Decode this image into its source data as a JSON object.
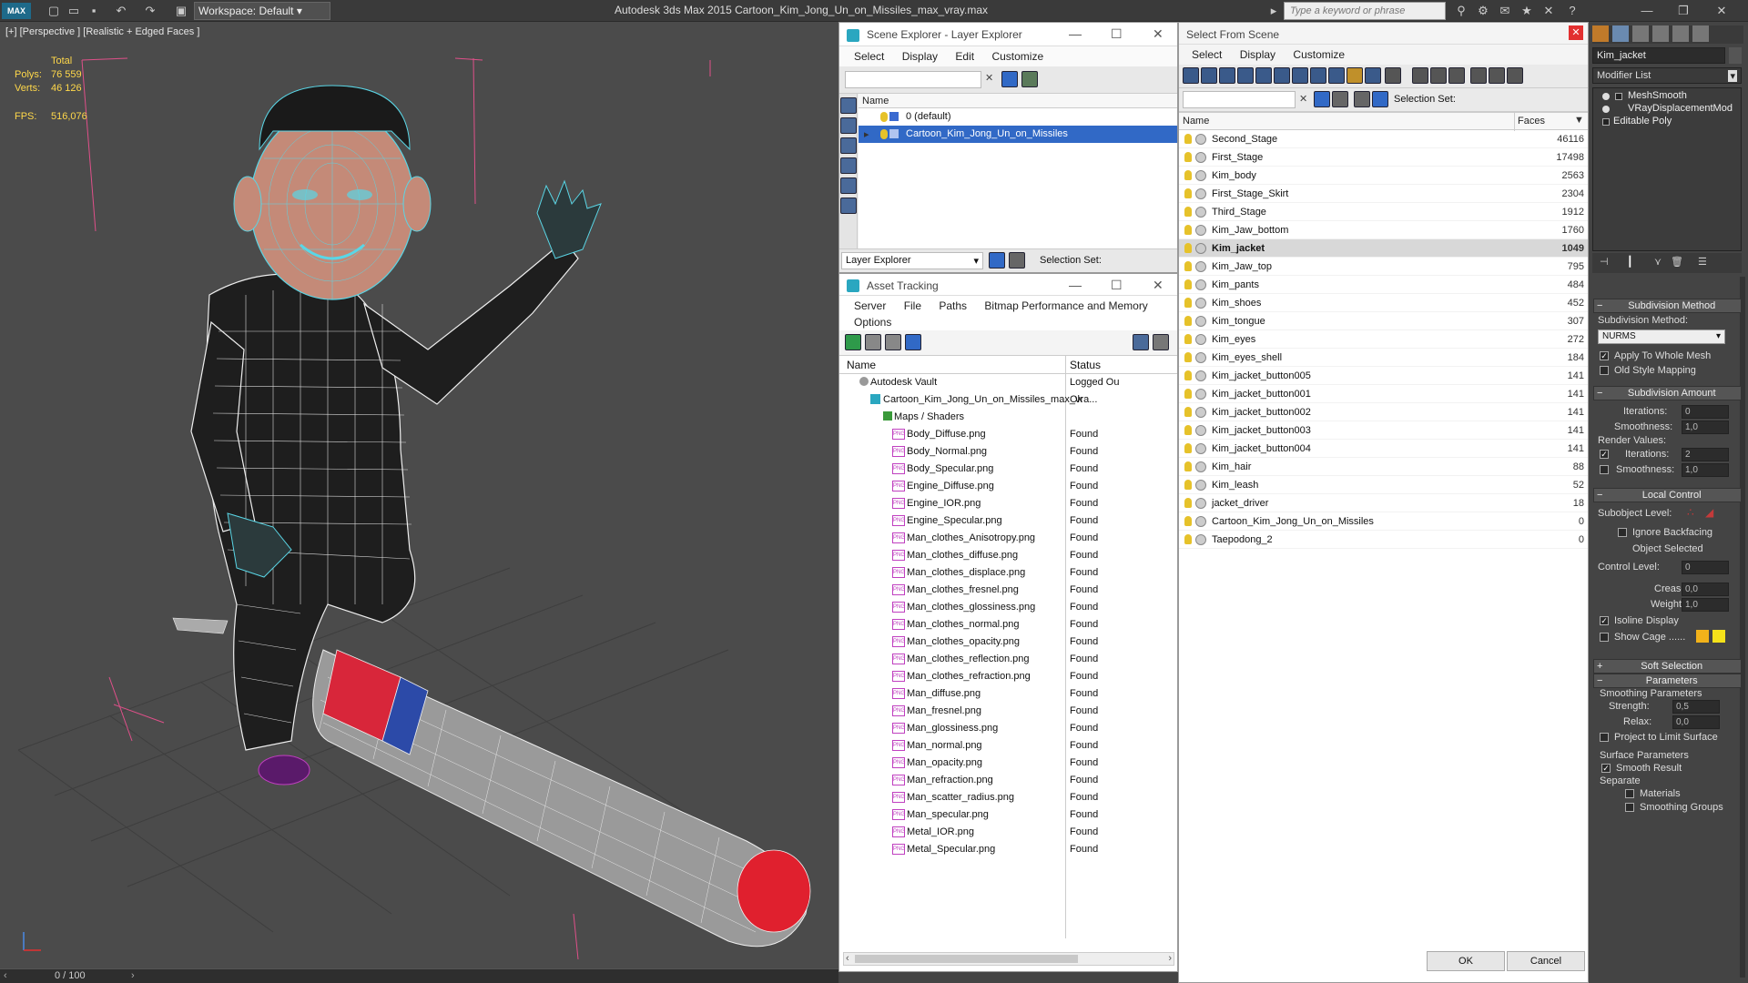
{
  "app": {
    "workspace_label": "Workspace: Default",
    "title": "Autodesk 3ds Max  2015    Cartoon_Kim_Jong_Un_on_Missiles_max_vray.max",
    "search_placeholder": "Type a keyword or phrase"
  },
  "viewport": {
    "label": "[+] [Perspective ] [Realistic + Edged Faces ]",
    "total_label": "Total",
    "polys_label": "Polys:",
    "polys_value": "76 559",
    "verts_label": "Verts:",
    "verts_value": "46 126",
    "fps_label": "FPS:",
    "fps_value": "516,076",
    "timeline": "0 / 100"
  },
  "scene_explorer": {
    "title": "Scene Explorer - Layer Explorer",
    "menu": [
      "Select",
      "Display",
      "Edit",
      "Customize"
    ],
    "col_name": "Name",
    "layers": [
      "0 (default)",
      "Cartoon_Kim_Jong_Un_on_Missiles"
    ],
    "footer_dropdown": "Layer Explorer",
    "footer_selection": "Selection Set:"
  },
  "asset_tracking": {
    "title": "Asset Tracking",
    "menu": [
      "Server",
      "File",
      "Paths",
      "Bitmap Performance and Memory"
    ],
    "menu2": "Options",
    "col_name": "Name",
    "col_status": "Status",
    "vault": {
      "name": "Autodesk Vault",
      "status": "Logged Ou"
    },
    "scene_file": {
      "name": "Cartoon_Kim_Jong_Un_on_Missiles_max_vra...",
      "status": "Ok"
    },
    "maps_folder": "Maps / Shaders",
    "files": [
      {
        "name": "Body_Diffuse.png",
        "status": "Found"
      },
      {
        "name": "Body_Normal.png",
        "status": "Found"
      },
      {
        "name": "Body_Specular.png",
        "status": "Found"
      },
      {
        "name": "Engine_Diffuse.png",
        "status": "Found"
      },
      {
        "name": "Engine_IOR.png",
        "status": "Found"
      },
      {
        "name": "Engine_Specular.png",
        "status": "Found"
      },
      {
        "name": "Man_clothes_Anisotropy.png",
        "status": "Found"
      },
      {
        "name": "Man_clothes_diffuse.png",
        "status": "Found"
      },
      {
        "name": "Man_clothes_displace.png",
        "status": "Found"
      },
      {
        "name": "Man_clothes_fresnel.png",
        "status": "Found"
      },
      {
        "name": "Man_clothes_glossiness.png",
        "status": "Found"
      },
      {
        "name": "Man_clothes_normal.png",
        "status": "Found"
      },
      {
        "name": "Man_clothes_opacity.png",
        "status": "Found"
      },
      {
        "name": "Man_clothes_reflection.png",
        "status": "Found"
      },
      {
        "name": "Man_clothes_refraction.png",
        "status": "Found"
      },
      {
        "name": "Man_diffuse.png",
        "status": "Found"
      },
      {
        "name": "Man_fresnel.png",
        "status": "Found"
      },
      {
        "name": "Man_glossiness.png",
        "status": "Found"
      },
      {
        "name": "Man_normal.png",
        "status": "Found"
      },
      {
        "name": "Man_opacity.png",
        "status": "Found"
      },
      {
        "name": "Man_refraction.png",
        "status": "Found"
      },
      {
        "name": "Man_scatter_radius.png",
        "status": "Found"
      },
      {
        "name": "Man_specular.png",
        "status": "Found"
      },
      {
        "name": "Metal_IOR.png",
        "status": "Found"
      },
      {
        "name": "Metal_Specular.png",
        "status": "Found"
      }
    ]
  },
  "select_from_scene": {
    "title": "Select From Scene",
    "menu": [
      "Select",
      "Display",
      "Customize"
    ],
    "selection_set": "Selection Set:",
    "col_name": "Name",
    "col_faces": "Faces",
    "objects": [
      {
        "name": "Second_Stage",
        "faces": "46116"
      },
      {
        "name": "First_Stage",
        "faces": "17498"
      },
      {
        "name": "Kim_body",
        "faces": "2563"
      },
      {
        "name": "First_Stage_Skirt",
        "faces": "2304"
      },
      {
        "name": "Third_Stage",
        "faces": "1912"
      },
      {
        "name": "Kim_Jaw_bottom",
        "faces": "1760"
      },
      {
        "name": "Kim_jacket",
        "faces": "1049",
        "selected": true
      },
      {
        "name": "Kim_Jaw_top",
        "faces": "795"
      },
      {
        "name": "Kim_pants",
        "faces": "484"
      },
      {
        "name": "Kim_shoes",
        "faces": "452"
      },
      {
        "name": "Kim_tongue",
        "faces": "307"
      },
      {
        "name": "Kim_eyes",
        "faces": "272"
      },
      {
        "name": "Kim_eyes_shell",
        "faces": "184"
      },
      {
        "name": "Kim_jacket_button005",
        "faces": "141"
      },
      {
        "name": "Kim_jacket_button001",
        "faces": "141"
      },
      {
        "name": "Kim_jacket_button002",
        "faces": "141"
      },
      {
        "name": "Kim_jacket_button003",
        "faces": "141"
      },
      {
        "name": "Kim_jacket_button004",
        "faces": "141"
      },
      {
        "name": "Kim_hair",
        "faces": "88"
      },
      {
        "name": "Kim_leash",
        "faces": "52"
      },
      {
        "name": "jacket_driver",
        "faces": "18"
      },
      {
        "name": "Cartoon_Kim_Jong_Un_on_Missiles",
        "faces": "0"
      },
      {
        "name": "Taepodong_2",
        "faces": "0"
      }
    ],
    "ok_label": "OK",
    "cancel_label": "Cancel"
  },
  "command_panel": {
    "object_name": "Kim_jacket",
    "modifier_list": "Modifier List",
    "stack": [
      "MeshSmooth",
      "VRayDisplacementMod",
      "Editable Poly"
    ],
    "subdivision_method_title": "Subdivision Method",
    "subdivision_method_label": "Subdivision Method:",
    "subdivision_method_value": "NURMS",
    "apply_whole_mesh": "Apply To Whole Mesh",
    "old_style_mapping": "Old Style Mapping",
    "subdivision_amount_title": "Subdivision Amount",
    "iterations_label": "Iterations:",
    "iterations_value": "0",
    "smoothness_label": "Smoothness:",
    "smoothness_value": "1,0",
    "render_values": "Render Values:",
    "render_iterations_label": "Iterations:",
    "render_iterations_value": "2",
    "render_smoothness_label": "Smoothness:",
    "render_smoothness_value": "1,0",
    "local_control_title": "Local Control",
    "subobject_level": "Subobject Level:",
    "ignore_backfacing": "Ignore Backfacing",
    "object_selected": "Object Selected",
    "control_level_label": "Control Level:",
    "control_level_value": "0",
    "crease_label": "Crease:",
    "crease_value": "0,0",
    "weight_label": "Weight:",
    "weight_value": "1,0",
    "isoline_display": "Isoline Display",
    "show_cage": "Show Cage ......",
    "soft_selection_title": "Soft Selection",
    "parameters_title": "Parameters",
    "smoothing_parameters": "Smoothing Parameters",
    "strength_label": "Strength:",
    "strength_value": "0,5",
    "relax_label": "Relax:",
    "relax_value": "0,0",
    "project_limit": "Project to Limit Surface",
    "surface_parameters": "Surface Parameters",
    "smooth_result": "Smooth Result",
    "separate": "Separate",
    "materials": "Materials",
    "smoothing_groups": "Smoothing Groups"
  },
  "colors": {
    "selection_blue": "#3169c6",
    "gizmo_pink": "#e0508a",
    "wire_cyan": "#5ad6e6"
  }
}
